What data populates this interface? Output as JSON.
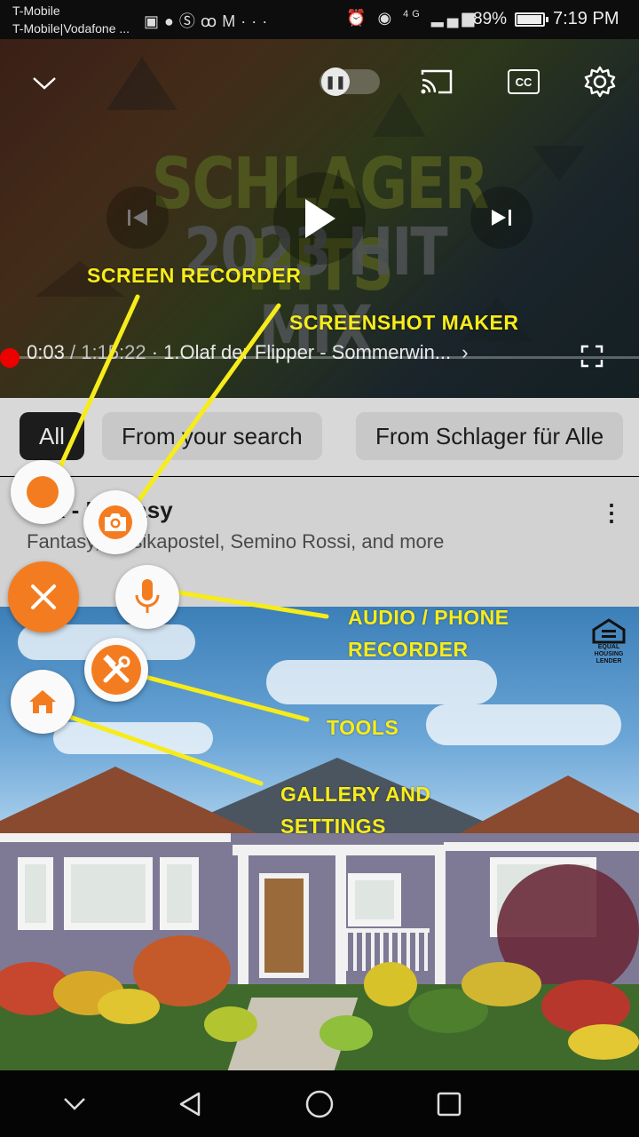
{
  "status_bar": {
    "carrier_line1": "T-Mobile",
    "carrier_line2": "T-Mobile|Vodafone ...",
    "notification_icons": [
      "image-icon",
      "chat-icon",
      "skype-icon",
      "voicemail-icon",
      "gmail-icon",
      "more-icon"
    ],
    "system_icons": [
      "alarm-icon",
      "eye-icon",
      "4g-signal-icon",
      "signal-icon"
    ],
    "network_label": "4G",
    "battery": "89%",
    "time": "7:19 PM"
  },
  "player": {
    "video_title_line1": "SCHLAGER HITS",
    "video_title_line2": "2023 HIT MIX",
    "autoplay_state": "paused",
    "cc_label": "CC",
    "current_time": "0:03",
    "separator": "/",
    "duration": "1:15:22",
    "chapter": "· 1.Olaf der Flipper - Sommerwin...",
    "chapter_chevron": "›",
    "progress_fraction": 0.0007
  },
  "chips": [
    {
      "label": "All",
      "selected": true
    },
    {
      "label": "From your search",
      "selected": false
    },
    {
      "label": "From Schlager für Alle",
      "selected": false
    }
  ],
  "mix": {
    "title": "Mix - Fantasy",
    "subtitle": "Fantasy, Musikapostel, Semino Rossi, and more",
    "more_glyph": "⋮"
  },
  "ad": {
    "badge_text_1": "EQUAL HOUSING",
    "badge_text_2": "LENDER"
  },
  "overlay": {
    "labels": {
      "screen_recorder": "SCREEN RECORDER",
      "screenshot_maker": "SCREENSHOT MAKER",
      "audio_line1": "AUDIO / PHONE",
      "audio_line2": "RECORDER",
      "tools": "TOOLS",
      "gallery_line1": "GALLERY AND",
      "gallery_line2": "SETTINGS"
    },
    "annotation_color": "#f7ec1a",
    "accent_color": "#f47c20"
  },
  "navbar": {
    "buttons": [
      "hide-keyboard-icon",
      "back-icon",
      "home-icon",
      "recents-icon"
    ]
  }
}
